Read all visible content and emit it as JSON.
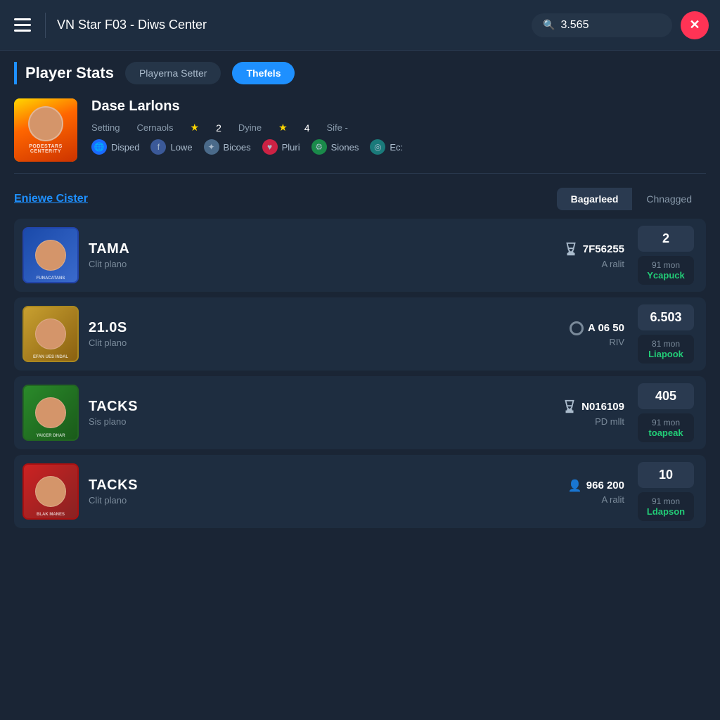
{
  "header": {
    "title": "VN Star F03 - Diws Center",
    "search_value": "3.565",
    "close_label": "✕"
  },
  "section": {
    "title": "Player Stats",
    "tab_inactive": "Playerna Setter",
    "tab_active": "Thefels"
  },
  "player_profile": {
    "name": "Dase Larlons",
    "stat1_label": "Setting",
    "stat2_label": "Cernaols",
    "stat3_star": "2",
    "stat4_label": "Dyine",
    "stat5_star": "4",
    "stat6_label": "Sife -",
    "badge1": "Disped",
    "badge2": "Lowe",
    "badge3": "Bicoes",
    "badge4": "Pluri",
    "badge5": "Siones",
    "badge6": "Ec:"
  },
  "browse": {
    "title": "Eniewe Cister",
    "tab_active": "Bagarleed",
    "tab_inactive": "Chnagged"
  },
  "players": [
    {
      "name": "TAMA",
      "subtitle": "Clit plano",
      "id": "7F56255",
      "sub": "A ralit",
      "score": "2",
      "detail_line1": "91 mon",
      "detail_line2": "Ycapuck",
      "icon_type": "trophy",
      "avatar_class": "card-avatar-1",
      "avatar_label": "FUNACATANS"
    },
    {
      "name": "21.0S",
      "subtitle": "Clit plano",
      "id": "A 06 50",
      "sub": "RIV",
      "score": "6.503",
      "detail_line1": "81 mon",
      "detail_line2": "Liapook",
      "icon_type": "ring",
      "avatar_class": "card-avatar-2",
      "avatar_label": "EFAN UES INDAL"
    },
    {
      "name": "TACKS",
      "subtitle": "Sis plano",
      "id": "N016109",
      "sub": "PD mllt",
      "score": "405",
      "detail_line1": "91 mon",
      "detail_line2": "toapeak",
      "icon_type": "trophy",
      "avatar_class": "card-avatar-3",
      "avatar_label": "YAICER DHAR"
    },
    {
      "name": "TACKS",
      "subtitle": "Clit plano",
      "id": "966 200",
      "sub": "A ralit",
      "score": "10",
      "detail_line1": "91 mon",
      "detail_line2": "Ldapson",
      "icon_type": "person",
      "avatar_class": "card-avatar-4",
      "avatar_label": "BLAK MANES"
    }
  ]
}
